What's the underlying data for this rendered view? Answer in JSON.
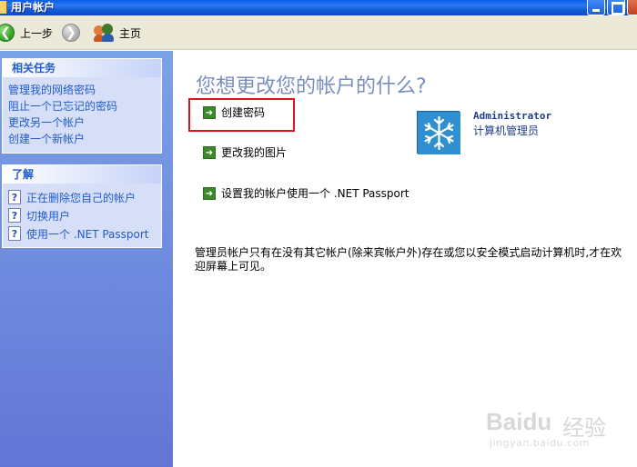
{
  "window": {
    "title": "用户帐户"
  },
  "toolbar": {
    "back_label": "上一步",
    "home_label": "主页"
  },
  "sidebar": {
    "related_tasks": {
      "title": "相关任务",
      "items": [
        "管理我的网络密码",
        "阻止一个已忘记的密码",
        "更改另一个帐户",
        "创建一个新帐户"
      ]
    },
    "learn_about": {
      "title": "了解",
      "items": [
        "正在删除您自己的帐户",
        "切换用户",
        "使用一个 .NET Passport"
      ]
    }
  },
  "main": {
    "heading": "您想更改您的帐户的什么?",
    "tasks": [
      "创建密码",
      "更改我的图片",
      "设置我的帐户使用一个 .NET Passport"
    ],
    "account": {
      "name": "Administrator",
      "role": "计算机管理员"
    },
    "note": "管理员帐户只有在没有其它帐户(除来宾帐户外)存在或您以安全模式启动计算机时,才在欢迎屏幕上可见。"
  },
  "watermark": {
    "brand": "Bai",
    "brand_du": "du",
    "brand_cn": "经验",
    "url": "jingyan.baidu.com"
  },
  "colors": {
    "titlebar": "#0a5de8",
    "left_pane": "#7ba2e7",
    "link": "#215dc6",
    "highlight": "#e0151b",
    "heading": "#7a8fbf"
  }
}
